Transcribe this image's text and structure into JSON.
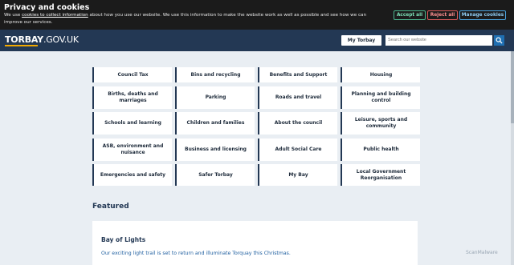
{
  "cookie_banner": {
    "title": "Privacy and cookies",
    "text_before_link": "We use ",
    "link_text": "cookies to collect information",
    "text_after_link": " about how you use our website. We use this information to make the website work as well as possible and see how we can improve our services.",
    "accept_label": "Accept all",
    "reject_label": "Reject all",
    "manage_label": "Manage cookies"
  },
  "header": {
    "logo_bold": "TORBAY",
    "logo_rest": ".GOV.UK",
    "my_torbay_label": "My Torbay",
    "search_placeholder": "Search our website",
    "search_icon": "search-icon"
  },
  "services": [
    "Council Tax",
    "Bins and recycling",
    "Benefits and Support",
    "Housing",
    "Births, deaths and marriages",
    "Parking",
    "Roads and travel",
    "Planning and building control",
    "Schools and learning",
    "Children and families",
    "About the council",
    "Leisure, sports and community",
    "ASB, environment and nuisance",
    "Business and licensing",
    "Adult Social Care",
    "Public health",
    "Emergencies and safety",
    "Safer Torbay",
    "My Bay",
    "Local Government Reorganisation"
  ],
  "featured": {
    "heading": "Featured",
    "card_title": "Bay of Lights",
    "card_text": "Our exciting light trail is set to return and illuminate Torquay this Christmas."
  },
  "watermark": "ScanMalware",
  "colors": {
    "header_bg": "#233854",
    "page_bg": "#e9eef3",
    "accent_yellow": "#f2a900",
    "search_button": "#1f6fb2"
  }
}
